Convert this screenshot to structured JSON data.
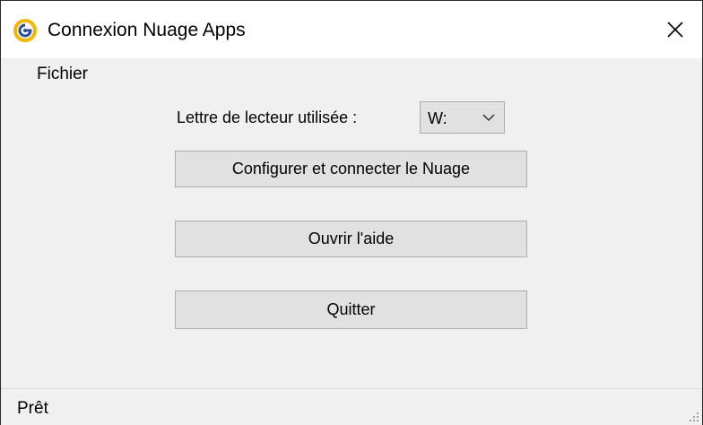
{
  "window": {
    "title": "Connexion Nuage Apps",
    "icon": "nuage-apps-logo-icon",
    "close_icon": "close-icon"
  },
  "menu": {
    "items": [
      {
        "label": "Fichier"
      }
    ]
  },
  "drive": {
    "label": "Lettre de lecteur utilisée :",
    "selected": "W:",
    "chevron_icon": "chevron-down-icon"
  },
  "buttons": {
    "configure": "Configurer et connecter le Nuage",
    "help": "Ouvrir l'aide",
    "quit": "Quitter"
  },
  "status": {
    "text": "Prêt"
  },
  "colors": {
    "window_bg": "#f0f0f0",
    "titlebar_bg": "#ffffff",
    "button_bg": "#e1e1e1",
    "button_border": "#adadad",
    "logo_yellow": "#f2b705",
    "logo_blue": "#2d4c9c"
  }
}
